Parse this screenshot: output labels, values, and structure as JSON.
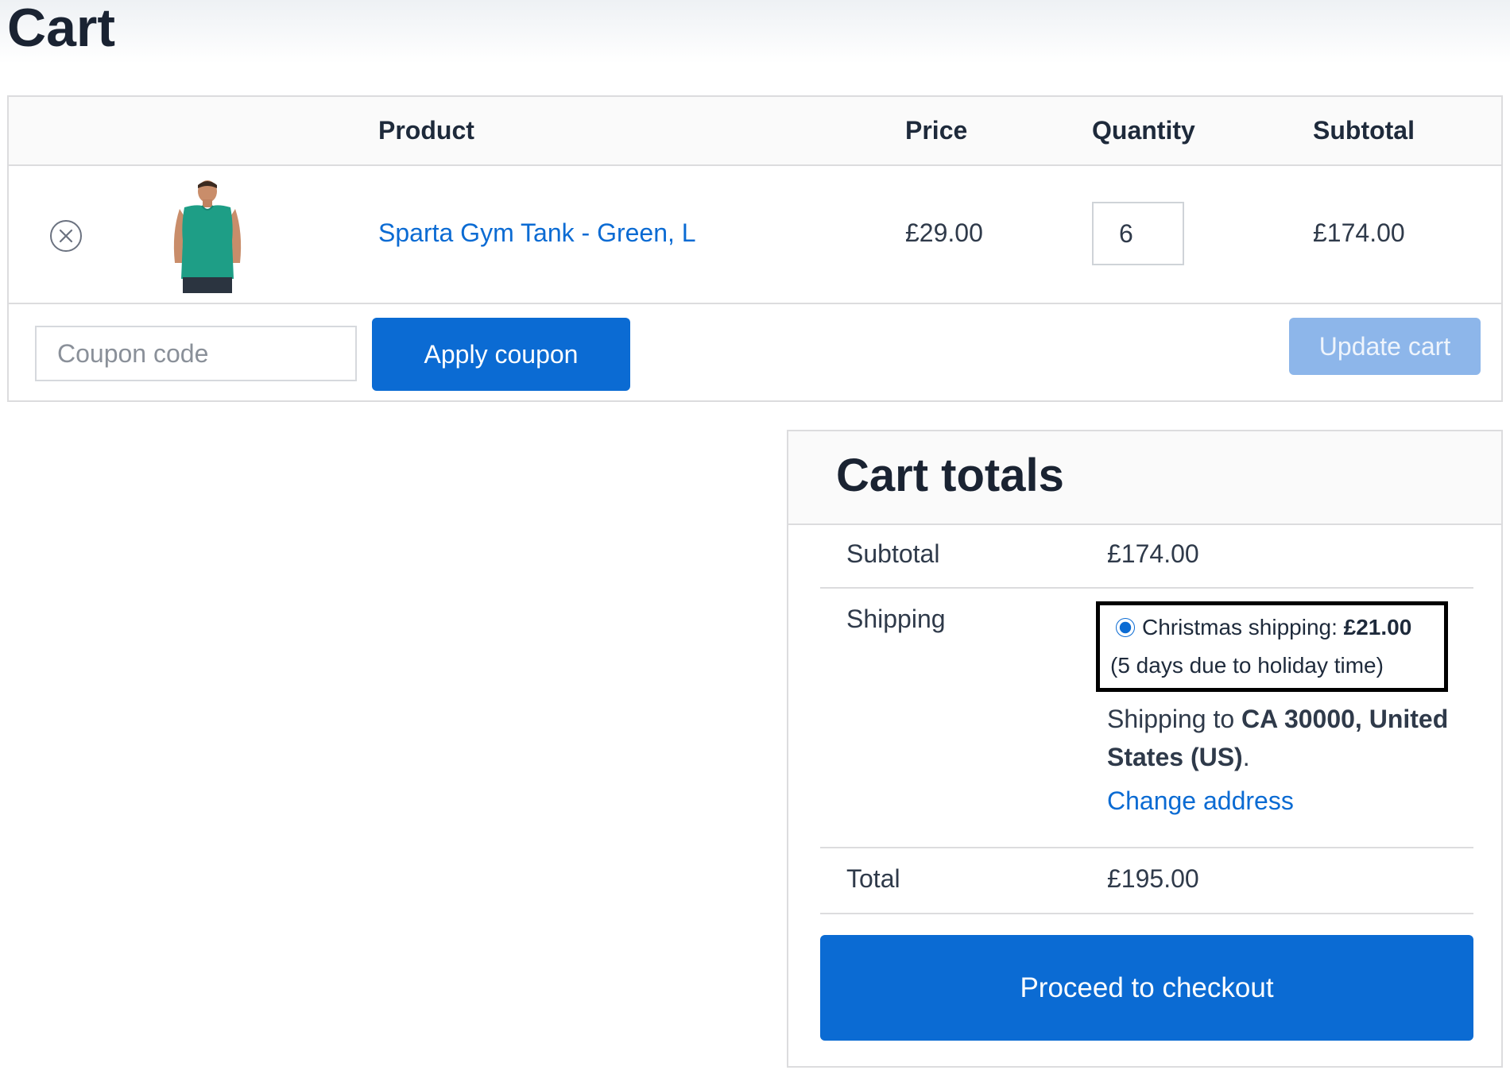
{
  "page": {
    "title": "Cart"
  },
  "cart_table": {
    "headers": {
      "product": "Product",
      "price": "Price",
      "quantity": "Quantity",
      "subtotal": "Subtotal"
    },
    "items": [
      {
        "name": "Sparta Gym Tank - Green, L",
        "price": "£29.00",
        "quantity": "6",
        "subtotal": "£174.00",
        "image_icon": "green-tank-top-photo"
      }
    ],
    "remove_icon": "remove-circle-x-icon"
  },
  "actions": {
    "coupon_placeholder": "Coupon code",
    "apply_coupon_label": "Apply coupon",
    "update_cart_label": "Update cart"
  },
  "totals": {
    "title": "Cart totals",
    "subtotal_label": "Subtotal",
    "subtotal_value": "£174.00",
    "shipping_label": "Shipping",
    "shipping_option": {
      "name": "Christmas shipping:",
      "price": "£21.00",
      "note": "(5 days due to holiday time)",
      "selected": true
    },
    "shipping_to_prefix": "Shipping to",
    "shipping_to_address": "CA 30000, United States (US)",
    "shipping_to_suffix": ".",
    "change_address_label": "Change address",
    "total_label": "Total",
    "total_value": "£195.00",
    "checkout_label": "Proceed to checkout"
  },
  "colors": {
    "accent": "#0b6bd3",
    "accent_disabled": "#8db6ea",
    "text": "#1e2a3b",
    "border": "#dcdcde",
    "product_green": "#1e9e86"
  }
}
